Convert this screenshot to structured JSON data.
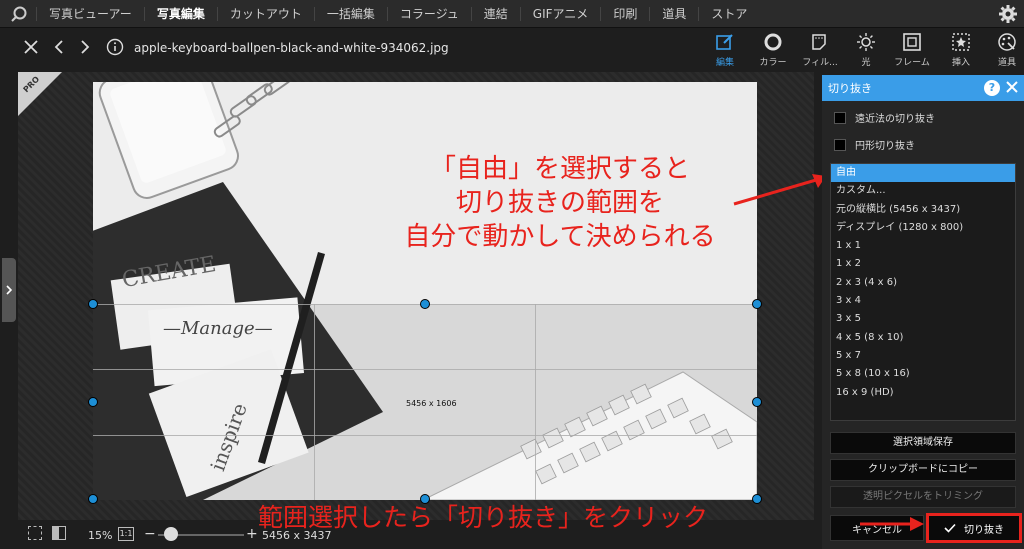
{
  "menu": {
    "items": [
      "写真ビューアー",
      "写真編集",
      "カットアウト",
      "一括編集",
      "コラージュ",
      "連結",
      "GIFアニメ",
      "印刷",
      "道具",
      "ストア"
    ],
    "active_index": 1
  },
  "toolbar": {
    "filename": "apple-keyboard-ballpen-black-and-white-934062.jpg",
    "tools": [
      "編集",
      "カラー",
      "フィル...",
      "光",
      "フレーム",
      "挿入",
      "道具"
    ]
  },
  "badge": {
    "text": "PRO"
  },
  "canvas": {
    "dims_label": "5456 x 1606"
  },
  "annotations": {
    "main_lines": [
      "「自由」を選択すると",
      "切り抜きの範囲を",
      "自分で動かして決められる"
    ],
    "bottom": "範囲選択したら「切り抜き」をクリック"
  },
  "statusbar": {
    "zoom": "15%",
    "one_to_one": "1:1",
    "minus": "−",
    "plus": "+",
    "size": "5456 x 3437"
  },
  "panel": {
    "title": "切り抜き",
    "help": "?",
    "checkboxes": [
      "遠近法の切り抜き",
      "円形切り抜き"
    ],
    "ratios": [
      "自由",
      "カスタム...",
      "元の縦横比 (5456 x 3437)",
      "ディスプレイ (1280 x 800)",
      "1 x 1",
      "1 x 2",
      "2 x 3 (4 x 6)",
      "3 x 4",
      "3 x 5",
      "4 x 5 (8 x 10)",
      "5 x 7",
      "5 x 8 (10 x 16)",
      "16 x 9 (HD)"
    ],
    "selected_ratio": "自由",
    "buttons": [
      "選択領域保存",
      "クリップボードにコピー",
      "透明ピクセルをトリミング"
    ],
    "cancel_label": "キャンセル",
    "crop_label": "切り抜き"
  },
  "colors": {
    "accent": "#3a9de8",
    "annotation_red": "#e8231d"
  }
}
